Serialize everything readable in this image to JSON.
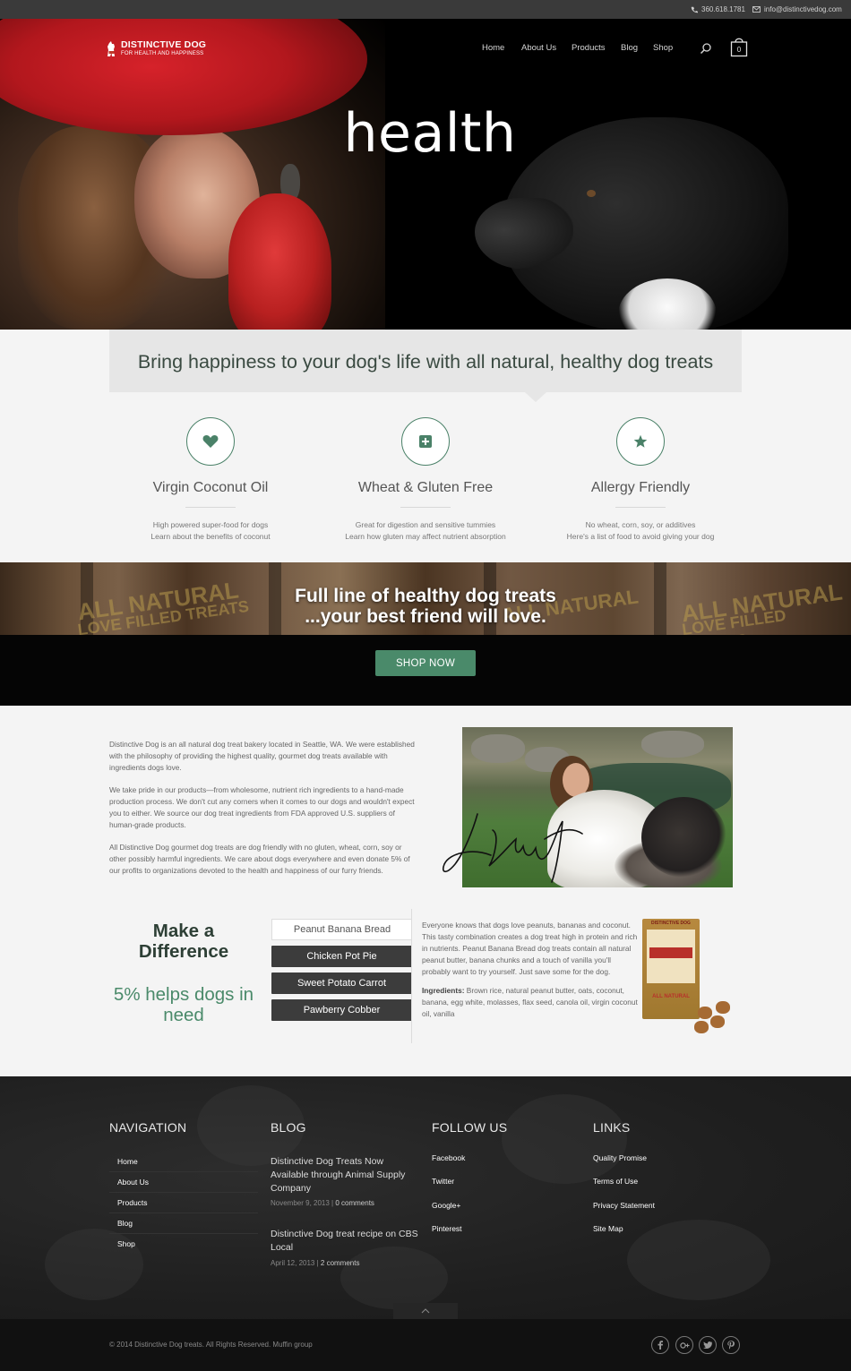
{
  "topbar": {
    "phone": "360.618.1781",
    "email": "info@distinctivedog.com"
  },
  "brand": {
    "name": "DISTINCTIVE DOG",
    "tagline": "FOR HEALTH AND HAPPINESS"
  },
  "nav": {
    "items": [
      "Home",
      "About Us",
      "Products",
      "Blog",
      "Shop"
    ],
    "cart_count": "0"
  },
  "hero": {
    "title": "health"
  },
  "banner": {
    "text": "Bring happiness to your dog's life with all natural, healthy dog treats"
  },
  "features": [
    {
      "icon": "heart-icon",
      "title": "Virgin Coconut Oil",
      "line1": "High powered super-food for dogs",
      "line2": "Learn about the benefits of coconut"
    },
    {
      "icon": "plus-icon",
      "title": "Wheat & Gluten Free",
      "line1": "Great for digestion and sensitive tummies",
      "line2": "Learn how gluten may affect nutrient absorption"
    },
    {
      "icon": "star-icon",
      "title": "Allergy Friendly",
      "line1": "No wheat, corn, soy, or additives",
      "line2": "Here's a list of food to avoid giving your dog"
    }
  ],
  "promo": {
    "line1": "Full line of healthy dog treats",
    "line2": "...your best friend will love.",
    "button": "SHOP NOW"
  },
  "about": {
    "p1": "Distinctive Dog is an all natural dog treat bakery located in Seattle, WA. We were established with the philosophy of providing the highest quality, gourmet dog treats available with ingredients dogs love.",
    "p2": "We take pride in our products—from wholesome, nutrient rich ingredients to a hand-made production process. We don't cut any corners when it comes to our dogs and wouldn't expect you to either. We source our dog treat ingredients from FDA approved U.S. suppliers of human-grade products.",
    "p3": "All Distinctive Dog gourmet dog treats are dog friendly with no gluten, wheat, corn, soy or other possibly harmful ingredients. We care about dogs everywhere and even donate 5% of our profits to organizations devoted to the health and happiness of our furry friends."
  },
  "difference": {
    "title_line1": "Make a",
    "title_line2": "Difference",
    "sub_line1": "5% helps dogs in",
    "sub_line2": "need"
  },
  "tabs": {
    "items": [
      "Peanut Banana Bread",
      "Chicken Pot Pie",
      "Sweet Potato Carrot",
      "Pawberry Cobber"
    ],
    "active_index": 0,
    "description": "Everyone knows that dogs love peanuts, bananas and coconut. This tasty combination creates a dog treat high in protein and rich in nutrients. Peanut Banana Bread dog treats contain all natural peanut butter, banana chunks and a touch of vanilla you'll probably want to try yourself. Just save some for the dog.",
    "ingredients_label": "Ingredients:",
    "ingredients": " Brown rice, natural peanut butter, oats, coconut, banana, egg white, molasses, flax seed, canola oil, virgin coconut oil, vanilla"
  },
  "product_bag": {
    "brand": "DISTINCTIVE DOG",
    "bottom": "ALL NATURAL"
  },
  "promo_bags": {
    "text1": "ALL NATURAL",
    "text2": "LOVE FILLED TREATS"
  },
  "footer": {
    "navigation": {
      "title": "NAVIGATION",
      "items": [
        "Home",
        "About Us",
        "Products",
        "Blog",
        "Shop"
      ]
    },
    "blog": {
      "title": "BLOG",
      "posts": [
        {
          "title": "Distinctive Dog Treats Now Available through Animal Supply Company",
          "date": "November 9, 2013 | ",
          "comments": "0 comments"
        },
        {
          "title": "Distinctive Dog treat recipe on CBS Local",
          "date": "April 12, 2013 | ",
          "comments": "2 comments"
        }
      ]
    },
    "follow": {
      "title": "FOLLOW US",
      "items": [
        "Facebook",
        "Twitter",
        "Google+",
        "Pinterest"
      ]
    },
    "links": {
      "title": "LINKS",
      "items": [
        "Quality Promise",
        "Terms of Use",
        "Privacy Statement",
        "Site Map"
      ]
    }
  },
  "bottom": {
    "copyright": "© 2014 Distinctive Dog treats. All Rights Reserved. Muffin group",
    "social": [
      "facebook-icon",
      "googleplus-icon",
      "twitter-icon",
      "pinterest-icon"
    ]
  },
  "colors": {
    "accent_green": "#4a8a6a",
    "dark_text_green": "#2d3f35",
    "topbar": "#3a3a3a",
    "footer": "#1f1f1f"
  }
}
